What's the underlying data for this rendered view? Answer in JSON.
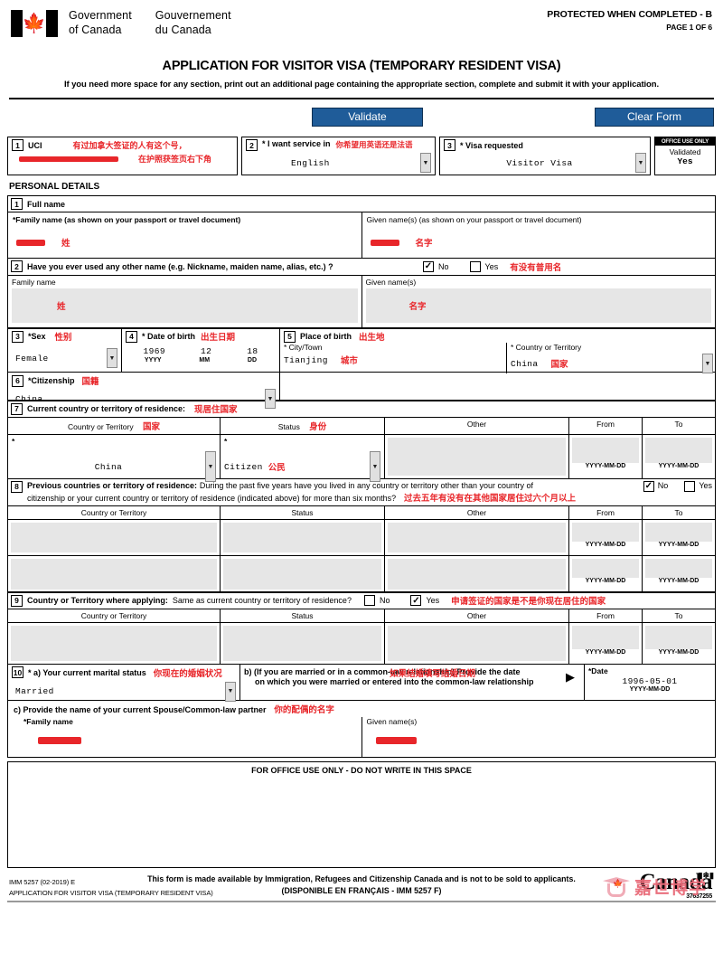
{
  "header": {
    "gov_en_line1": "Government",
    "gov_en_line2": "of Canada",
    "gov_fr_line1": "Gouvernement",
    "gov_fr_line2": "du Canada",
    "flag_icon": "canada-flag-icon",
    "protected": "PROTECTED WHEN COMPLETED - B",
    "page_of": "PAGE 1 OF 6"
  },
  "title": {
    "main": "APPLICATION FOR VISITOR VISA (TEMPORARY RESIDENT VISA)",
    "sub": "If you need more space for any section, print out an additional page containing the appropriate section, complete and submit it with your application."
  },
  "toolbar": {
    "validate_label": "Validate",
    "clear_label": "Clear Form",
    "accent": "#1f5c99"
  },
  "top_row": {
    "uci": {
      "num": "1",
      "label": "UCI",
      "value_redacted": "██████████",
      "note_line1": "有过加拿大签证的人有这个号，",
      "note_line2": "在护照获签页右下角"
    },
    "service": {
      "num": "2",
      "label": "* I want service in",
      "value": "English",
      "note": "你希望用英语还是法语"
    },
    "visa": {
      "num": "3",
      "label": "* Visa requested",
      "value": "Visitor Visa"
    },
    "office": {
      "title": "OFFICE USE ONLY",
      "line1": "Validated",
      "line2": "Yes"
    }
  },
  "personal_details_heading": "PERSONAL DETAILS",
  "s1": {
    "num": "1",
    "heading": "Full name",
    "family_label": "*Family name  (as shown on your passport or travel document)",
    "family_value_redacted": "████",
    "family_note": "姓",
    "given_label": "Given name(s)  (as shown on your passport or travel document)",
    "given_value_redacted": "████",
    "given_note": "名字"
  },
  "s2": {
    "num": "2",
    "question": "Have you ever used any other name (e.g. Nickname, maiden name, alias, etc.) ?",
    "no_label": "No",
    "yes_label": "Yes",
    "no_checked": true,
    "yes_checked": false,
    "note": "有没有普用名",
    "family_label": "Family name",
    "family_note": "姓",
    "given_label": "Given name(s)",
    "given_note": "名字"
  },
  "s3": {
    "num": "3",
    "label": "*Sex",
    "note": "性别",
    "value": "Female"
  },
  "s4": {
    "num": "4",
    "label": "* Date of birth",
    "note": "出生日期",
    "yyyy": "1969",
    "mm": "12",
    "dd": "18",
    "yyyy_label": "YYYY",
    "mm_label": "MM",
    "dd_label": "DD"
  },
  "s5": {
    "num": "5",
    "label": "Place of birth",
    "note": "出生地",
    "city_label": "* City/Town",
    "city_value": "Tianjing",
    "city_note": "城市",
    "country_label": "* Country or Territory",
    "country_value": "China",
    "country_note": "国家"
  },
  "s6": {
    "num": "6",
    "label": "*Citizenship",
    "note": "国籍",
    "value": "China"
  },
  "s7": {
    "num": "7",
    "label": "Current country or territory of residence:",
    "note": "现居住国家",
    "columns": [
      "Country or Territory",
      "Status",
      "Other",
      "From",
      "To"
    ],
    "col_note_country": "国家",
    "col_note_status": "身份",
    "country_value": "China",
    "status_value": "Citizen",
    "status_note": "公民",
    "other_value": "",
    "from_value": "",
    "to_value": "",
    "date_format": "YYYY-MM-DD"
  },
  "s8": {
    "num": "8",
    "label": "Previous countries or territory of residence:",
    "question_line1": "During the past five years have you lived in any country or territory other than your country of",
    "question_line2": "citizenship or your current country or territory of residence (indicated above) for more than six months?",
    "note": "过去五年有没有在其他国家居住过六个月以上",
    "no_label": "No",
    "yes_label": "Yes",
    "no_checked": true,
    "yes_checked": false,
    "columns": [
      "Country or Territory",
      "Status",
      "Other",
      "From",
      "To"
    ],
    "rows": [
      {
        "country": "",
        "status": "",
        "other": "",
        "from": "",
        "to": ""
      },
      {
        "country": "",
        "status": "",
        "other": "",
        "from": "",
        "to": ""
      }
    ],
    "date_format": "YYYY-MM-DD"
  },
  "s9": {
    "num": "9",
    "label": "Country or Territory where applying:",
    "question": "Same as current country or territory of residence?",
    "no_label": "No",
    "yes_label": "Yes",
    "no_checked": false,
    "yes_checked": true,
    "note": "申请签证的国家是不是你现在居住的国家",
    "columns": [
      "Country or Territory",
      "Status",
      "Other",
      "From",
      "To"
    ],
    "row": {
      "country": "",
      "status": "",
      "other": "",
      "from": "",
      "to": ""
    },
    "date_format": "YYYY-MM-DD"
  },
  "s10": {
    "num": "10",
    "a_label": "* a) Your current marital status",
    "a_note": "你现在的婚姻状况",
    "a_value": "Married",
    "b_line1": "b) (If you are married or in a common-law relationship) Provide the date",
    "b_line2": "on which you were married or entered into the common-law relationship",
    "b_note": "如果结婚填写结婚日期",
    "date_label": "*Date",
    "date_value": "1996-05-01",
    "date_format": "YYYY-MM-DD",
    "c_label": "c) Provide the name of your current Spouse/Common-law partner",
    "c_note": "你的配偶的名字",
    "c_family_label": "*Family name",
    "c_family_redacted": "█████",
    "c_given_label": "Given name(s)",
    "c_given_redacted": "█████"
  },
  "office_use": {
    "caption": "FOR OFFICE USE ONLY - DO NOT WRITE IN THIS SPACE"
  },
  "footer": {
    "line1": "This form is made available by Immigration, Refugees and Citizenship Canada and is not to be sold to applicants.",
    "line2": "(DISPONIBLE EN FRANÇAIS - IMM 5257 F)",
    "form_id": "IMM 5257 (02-2019) E",
    "form_name": "APPLICATION FOR VISITOR VISA (TEMPORARY RESIDENT VISA)",
    "canada_word": "Canada",
    "barcode_number": "37637255",
    "watermark_text": "嘉世博学"
  }
}
